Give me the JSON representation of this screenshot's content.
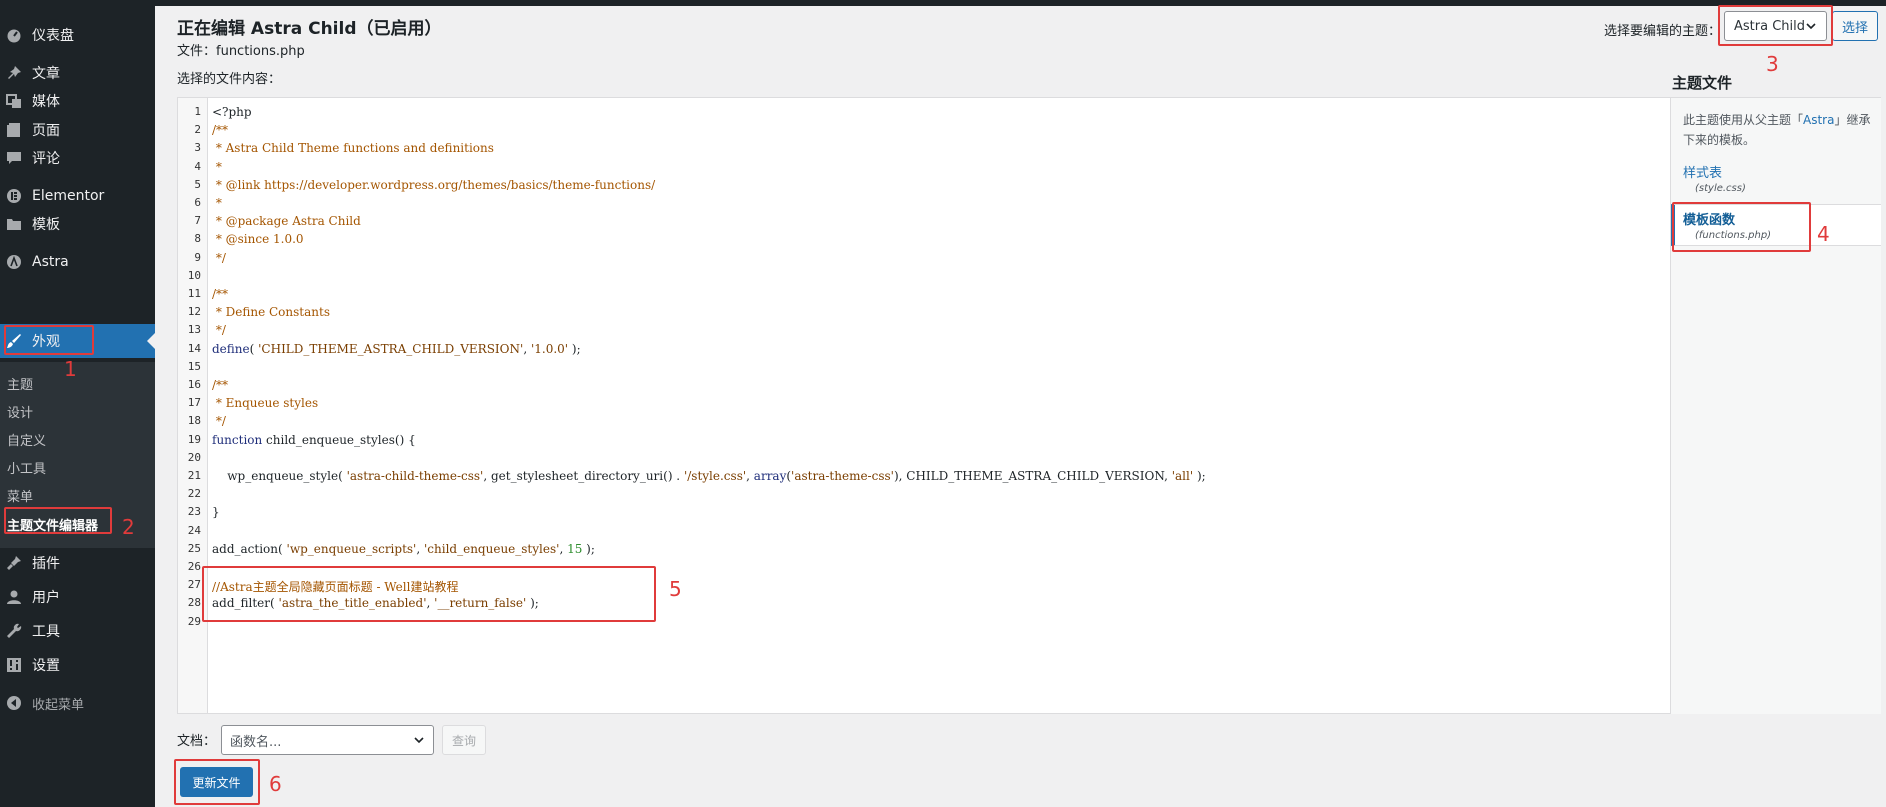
{
  "sidebar": {
    "items": [
      {
        "label": "仪表盘",
        "icon": "dashboard-icon"
      },
      {
        "label": "文章",
        "icon": "pin-icon"
      },
      {
        "label": "媒体",
        "icon": "media-icon"
      },
      {
        "label": "页面",
        "icon": "page-icon"
      },
      {
        "label": "评论",
        "icon": "comment-icon"
      },
      {
        "label": "Elementor",
        "icon": "elementor-icon"
      },
      {
        "label": "模板",
        "icon": "folder-icon"
      },
      {
        "label": "Astra",
        "icon": "astra-icon"
      },
      {
        "label": "外观",
        "icon": "brush-icon"
      },
      {
        "label": "插件",
        "icon": "plugin-icon"
      },
      {
        "label": "用户",
        "icon": "user-icon"
      },
      {
        "label": "工具",
        "icon": "wrench-icon"
      },
      {
        "label": "设置",
        "icon": "settings-icon"
      }
    ],
    "submenu": [
      "主题",
      "设计",
      "自定义",
      "小工具",
      "菜单",
      "主题文件编辑器"
    ],
    "collapse_label": "收起菜单"
  },
  "header": {
    "title": "正在编辑 Astra Child（已启用）",
    "file_info": "文件：functions.php",
    "content_label": "选择的文件内容："
  },
  "theme_picker": {
    "label": "选择要编辑的主题：",
    "selected": "Astra Child",
    "button": "选择"
  },
  "code": {
    "line_numbers": [
      "1",
      "2",
      "3",
      "4",
      "5",
      "6",
      "7",
      "8",
      "9",
      "10",
      "11",
      "12",
      "13",
      "14",
      "15",
      "16",
      "17",
      "18",
      "19",
      "20",
      "21",
      "22",
      "23",
      "24",
      "25",
      "26",
      "27",
      "28",
      "29"
    ],
    "lines": [
      "<?php",
      "/**",
      " * Astra Child Theme functions and definitions",
      " *",
      " * @link https://developer.wordpress.org/themes/basics/theme-functions/",
      " *",
      " * @package Astra Child",
      " * @since 1.0.0",
      " */",
      "",
      "/**",
      " * Define Constants",
      " */",
      "define( 'CHILD_THEME_ASTRA_CHILD_VERSION', '1.0.0' );",
      "",
      "/**",
      " * Enqueue styles",
      " */",
      "function child_enqueue_styles() {",
      "",
      "    wp_enqueue_style( 'astra-child-theme-css', get_stylesheet_directory_uri() . '/style.css', array('astra-theme-css'), CHILD_THEME_ASTRA_CHILD_VERSION, 'all' );",
      "",
      "}",
      "",
      "add_action( 'wp_enqueue_scripts', 'child_enqueue_styles', 15 );",
      "",
      "//Astra主题全局隐藏页面标题 - Well建站教程",
      "add_filter( 'astra_the_title_enabled', '__return_false' );",
      ""
    ]
  },
  "theme_files": {
    "heading": "主题文件",
    "desc_prefix": "此主题使用从父主题「",
    "desc_link": "Astra",
    "desc_suffix": "」继承下来的模板。",
    "files": [
      {
        "name": "样式表",
        "file": "(style.css)"
      },
      {
        "name": "模板函数",
        "file": "(functions.php)"
      }
    ]
  },
  "docs": {
    "label": "文档：",
    "placeholder": "函数名...",
    "query_button": "查询"
  },
  "update_button": "更新文件",
  "annotations": [
    "1",
    "2",
    "3",
    "4",
    "5",
    "6"
  ]
}
